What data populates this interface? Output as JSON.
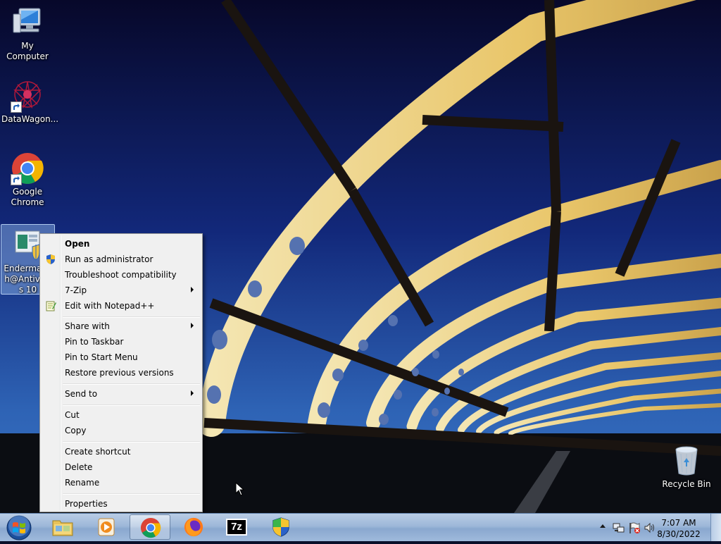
{
  "desktop": {
    "icons": [
      {
        "label": "My Computer"
      },
      {
        "label": "DataWagon..."
      },
      {
        "label": "Google Chrome"
      },
      {
        "label": "Endermanch@Antivirus 10"
      },
      {
        "label": "Recycle Bin"
      }
    ]
  },
  "context_menu": {
    "items": [
      {
        "label": "Open"
      },
      {
        "label": "Run as administrator",
        "icon": "uac-shield-icon"
      },
      {
        "label": "Troubleshoot compatibility"
      },
      {
        "label": "7-Zip",
        "submenu": true
      },
      {
        "label": "Edit with Notepad++",
        "icon": "notepadpp-icon"
      },
      {
        "label": "Share with",
        "submenu": true
      },
      {
        "label": "Pin to Taskbar"
      },
      {
        "label": "Pin to Start Menu"
      },
      {
        "label": "Restore previous versions"
      },
      {
        "label": "Send to",
        "submenu": true
      },
      {
        "label": "Cut"
      },
      {
        "label": "Copy"
      },
      {
        "label": "Create shortcut"
      },
      {
        "label": "Delete"
      },
      {
        "label": "Rename"
      },
      {
        "label": "Properties"
      }
    ]
  },
  "taskbar": {
    "buttons": [
      {
        "icon": "windows-explorer-icon"
      },
      {
        "icon": "media-player-icon"
      },
      {
        "icon": "chrome-icon",
        "active": true
      },
      {
        "icon": "firefox-icon"
      },
      {
        "icon": "7zip-icon",
        "text": "7z"
      },
      {
        "icon": "security-shield-icon"
      }
    ],
    "clock": {
      "time": "7:07 AM",
      "date": "8/30/2022"
    }
  },
  "colors": {
    "taskbar": "#9db7d8",
    "menu_bg": "#f0f0f0",
    "selection": "#96bef0"
  }
}
